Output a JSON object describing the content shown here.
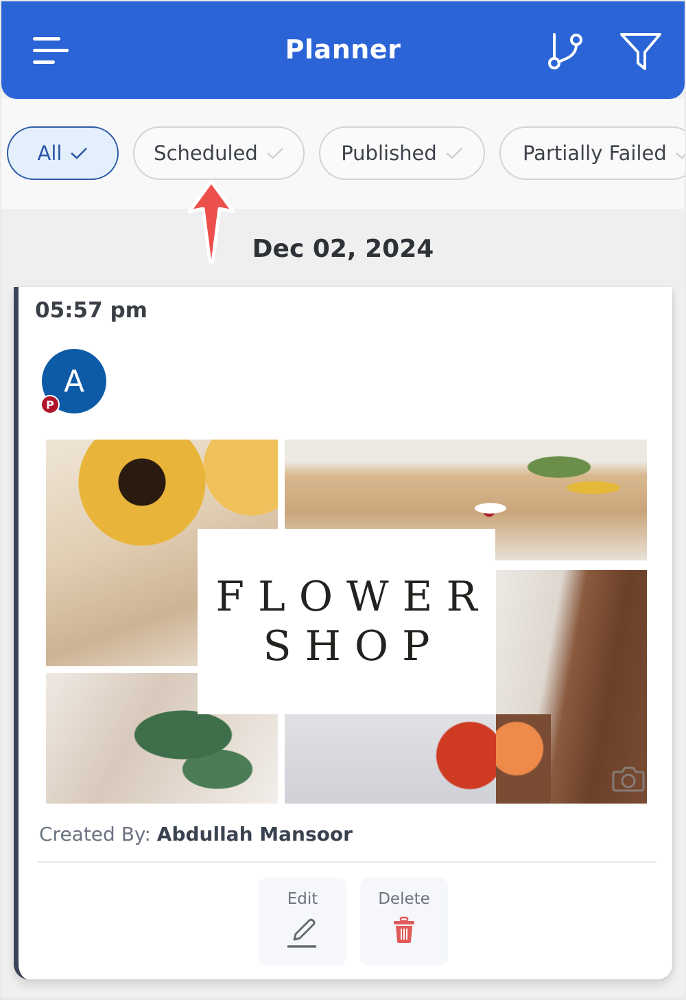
{
  "header": {
    "title": "Planner",
    "menu_icon": "hamburger-menu-icon",
    "actions": [
      {
        "icon": "git-branch-icon"
      },
      {
        "icon": "filter-icon"
      }
    ],
    "color": "#2b64d6"
  },
  "filters": {
    "chips": [
      {
        "label": "All",
        "selected": true
      },
      {
        "label": "Scheduled",
        "selected": false
      },
      {
        "label": "Published",
        "selected": false
      },
      {
        "label": "Partially Failed",
        "selected": false
      }
    ]
  },
  "annotation": {
    "icon": "red-up-arrow",
    "color": "#ec4f4c"
  },
  "date_group": {
    "date": "Dec 02, 2024"
  },
  "post": {
    "time": "05:57 pm",
    "account_initial": "A",
    "platform_badge": "P",
    "platform_icon": "pinterest-icon",
    "media_text_line1": "FLOWER",
    "media_text_line2": "SHOP",
    "media_icon": "camera-icon",
    "created_by_label": "Created By:",
    "created_by_name": "Abdullah Mansoor",
    "actions": {
      "edit_label": "Edit",
      "delete_label": "Delete"
    },
    "delete_color": "#e05a5a"
  }
}
